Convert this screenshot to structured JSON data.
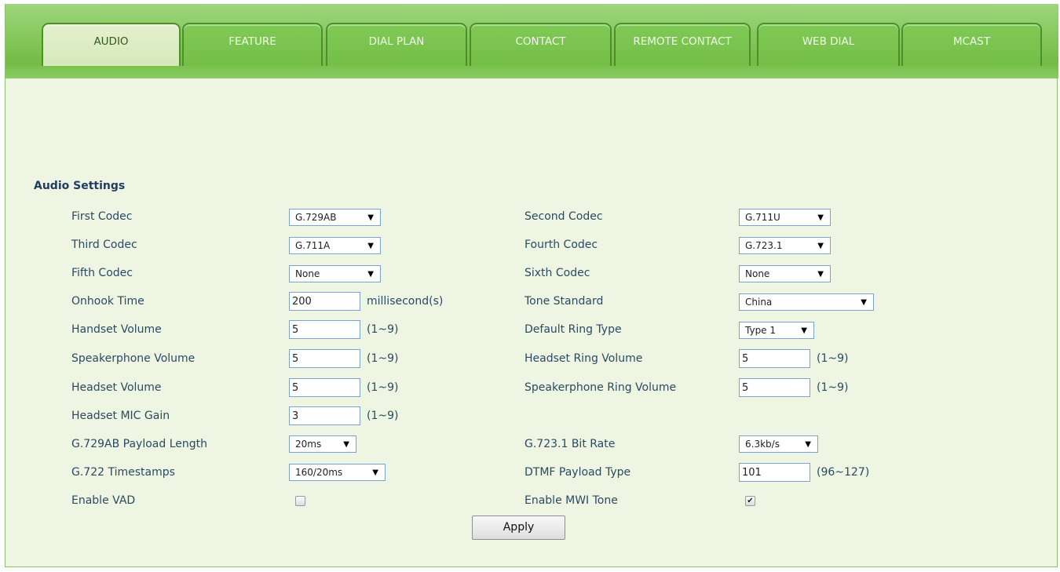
{
  "tabs": [
    "AUDIO",
    "FEATURE",
    "DIAL PLAN",
    "CONTACT",
    "REMOTE CONTACT",
    "WEB DIAL",
    "MCAST"
  ],
  "section_title": "Audio Settings",
  "left": [
    {
      "label": "First Codec",
      "value": "G.729AB"
    },
    {
      "label": "Third Codec",
      "value": "G.711A"
    },
    {
      "label": "Fifth Codec",
      "value": "None"
    },
    {
      "label": "Onhook Time",
      "value": "200",
      "unit": "millisecond(s)"
    },
    {
      "label": "Handset Volume",
      "value": "5",
      "unit": "(1~9)"
    },
    {
      "label": "Speakerphone Volume",
      "value": "5",
      "unit": "(1~9)"
    },
    {
      "label": "Headset Volume",
      "value": "5",
      "unit": "(1~9)"
    },
    {
      "label": "Headset MIC Gain",
      "value": "3",
      "unit": "(1~9)"
    },
    {
      "label": "G.729AB Payload Length",
      "value": "20ms"
    },
    {
      "label": "G.722 Timestamps",
      "value": "160/20ms"
    },
    {
      "label": "Enable VAD",
      "checked": false
    }
  ],
  "right": [
    {
      "label": "Second Codec",
      "value": "G.711U"
    },
    {
      "label": "Fourth Codec",
      "value": "G.723.1"
    },
    {
      "label": "Sixth Codec",
      "value": "None"
    },
    {
      "label": "Tone Standard",
      "value": "China"
    },
    {
      "label": "Default Ring Type",
      "value": "Type 1"
    },
    {
      "label": "Headset Ring Volume",
      "value": "5",
      "unit": "(1~9)"
    },
    {
      "label": "Speakerphone Ring Volume",
      "value": "5",
      "unit": "(1~9)"
    },
    {
      "label": "G.723.1 Bit Rate",
      "value": "6.3kb/s"
    },
    {
      "label": "DTMF Payload Type",
      "value": "101",
      "unit": "(96~127)"
    },
    {
      "label": "Enable MWI Tone",
      "checked": true
    }
  ],
  "apply_label": "Apply",
  "icons": {
    "dropdown": "caret-down-icon",
    "checkbox": "checkbox-icon"
  },
  "colors": {
    "tab_bar": "#77bf4a",
    "active_tab": "#d6e9b9",
    "panel_bg": "#eef5e3",
    "label_text": "#2a4a63"
  }
}
